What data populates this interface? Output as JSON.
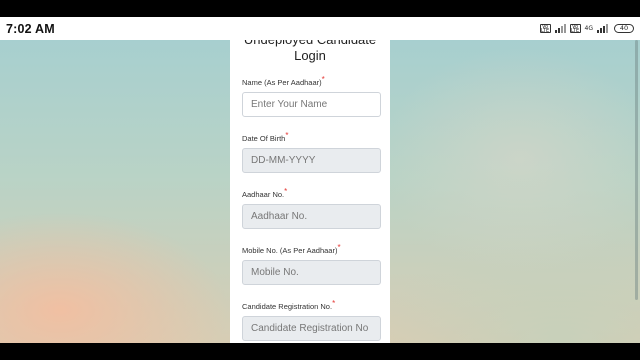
{
  "status_bar": {
    "time": "7:02 AM",
    "sim1_label": "Vo LTE",
    "sim2_label": "Vo LTE",
    "network": "4G",
    "battery": "40"
  },
  "form": {
    "title_line1": "Undeployed Candidate",
    "title_line2": "Login",
    "fields": [
      {
        "label": "Name (As Per Aadhaar)",
        "placeholder": "Enter Your Name"
      },
      {
        "label": "Date Of Birth",
        "placeholder": "DD-MM-YYYY"
      },
      {
        "label": "Aadhaar No.",
        "placeholder": "Aadhaar No."
      },
      {
        "label": "Mobile No. (As Per Aadhaar)",
        "placeholder": "Mobile No."
      },
      {
        "label": "Candidate Registration No.",
        "placeholder": "Candidate Registration No"
      }
    ],
    "required_mark": "*"
  }
}
